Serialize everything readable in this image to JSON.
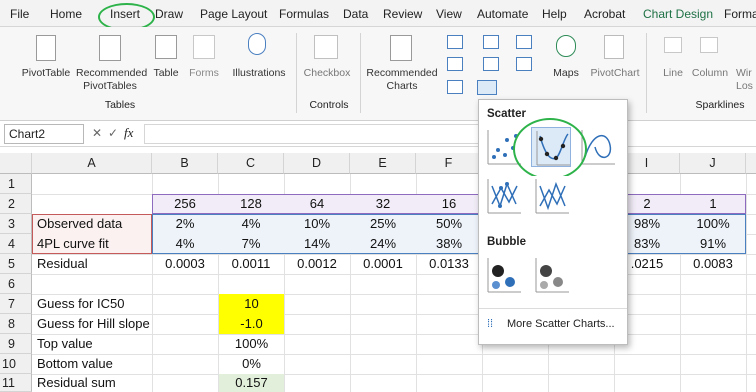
{
  "menu_tabs": [
    "File",
    "Home",
    "Insert",
    "Draw",
    "Page Layout",
    "Formulas",
    "Data",
    "Review",
    "View",
    "Automate",
    "Help",
    "Acrobat",
    "Chart Design",
    "Forma"
  ],
  "ribbon": {
    "pivottable": "PivotTable",
    "recommended_pivot": "Recommended",
    "recommended_pivot2": "PivotTables",
    "table": "Table",
    "forms": "Forms",
    "illustrations": "Illustrations",
    "checkbox": "Checkbox",
    "recommended_charts": "Recommended",
    "recommended_charts2": "Charts",
    "maps": "Maps",
    "pivotchart": "PivotChart",
    "line": "Line",
    "column": "Column",
    "winloss": "Wir",
    "winloss2": "Los",
    "group_tables": "Tables",
    "group_controls": "Controls",
    "group_sparklines": "Sparklines"
  },
  "namebox": "Chart2",
  "fx_label": "fx",
  "columns": [
    "A",
    "B",
    "C",
    "D",
    "E",
    "F",
    "G",
    "H",
    "I",
    "J"
  ],
  "rows": [
    "1",
    "2",
    "3",
    "4",
    "5",
    "6",
    "7",
    "8",
    "9",
    "10",
    "11"
  ],
  "cells": {
    "r2": [
      "",
      "256",
      "128",
      "64",
      "32",
      "16",
      "",
      "",
      "2",
      "1"
    ],
    "r3": [
      "Observed data",
      "2%",
      "4%",
      "10%",
      "25%",
      "50%",
      "",
      "",
      "98%",
      "100%"
    ],
    "r4": [
      "4PL curve fit",
      "4%",
      "7%",
      "14%",
      "24%",
      "38%",
      "",
      "",
      "83%",
      "91%"
    ],
    "r5": [
      "Residual",
      "0.0003",
      "0.0011",
      "0.0012",
      "0.0001",
      "0.0133",
      "",
      "",
      ".0215",
      "0.0083"
    ],
    "r7": [
      "Guess for IC50",
      "",
      "10"
    ],
    "r8": [
      "Guess for Hill slope",
      "",
      "-1.0"
    ],
    "r9": [
      "Top value",
      "",
      "100%"
    ],
    "r10": [
      "Bottom value",
      "",
      "0%"
    ],
    "r11": [
      "Residual sum",
      "",
      "0.157"
    ]
  },
  "dropdown": {
    "scatter_header": "Scatter",
    "bubble_header": "Bubble",
    "more": "More Scatter Charts..."
  },
  "colors": {
    "highlight_yellow": "#ffff00",
    "highlight_green": "#e2efda",
    "annotation_green": "#2db34a",
    "chart_design": "#1e7145"
  }
}
